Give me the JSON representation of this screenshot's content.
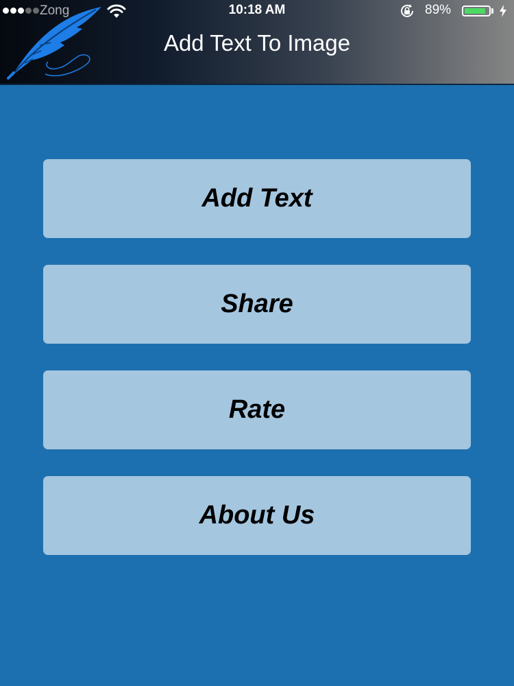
{
  "status_bar": {
    "carrier": "Zong",
    "time": "10:18 AM",
    "battery_percent": "89%",
    "battery_level": 0.89,
    "battery_color": "#4cd964"
  },
  "nav_bar": {
    "title": "Add Text To Image",
    "logo_icon": "feather-quill-icon"
  },
  "menu": {
    "buttons": [
      {
        "label": "Add Text"
      },
      {
        "label": "Share"
      },
      {
        "label": "Rate"
      },
      {
        "label": "About Us"
      }
    ]
  },
  "colors": {
    "background": "#1d70b0",
    "button": "#a5c6df",
    "logo": "#1e7de6"
  }
}
